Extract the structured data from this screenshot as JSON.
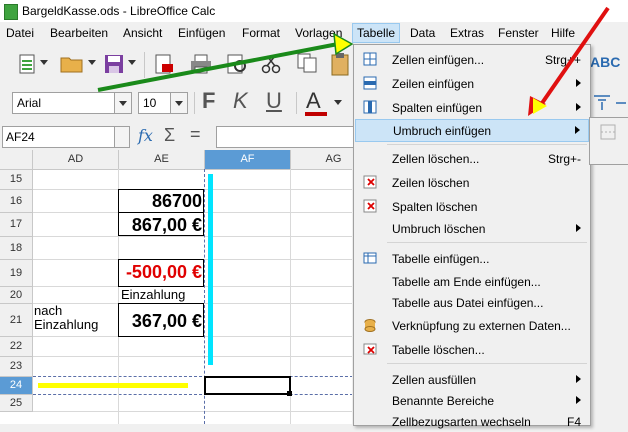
{
  "window": {
    "title": "BargeldKasse.ods - LibreOffice Calc"
  },
  "menubar": [
    {
      "id": "datei",
      "label": "Datei"
    },
    {
      "id": "bearbeiten",
      "label": "Bearbeiten"
    },
    {
      "id": "ansicht",
      "label": "Ansicht"
    },
    {
      "id": "einfuegen",
      "label": "Einfügen"
    },
    {
      "id": "format",
      "label": "Format"
    },
    {
      "id": "vorlagen",
      "label": "Vorlagen"
    },
    {
      "id": "tabelle",
      "label": "Tabelle"
    },
    {
      "id": "daten",
      "label": "Data"
    },
    {
      "id": "extras",
      "label": "Extras"
    },
    {
      "id": "fenster",
      "label": "Fenster"
    },
    {
      "id": "hilfe",
      "label": "Hilfe"
    }
  ],
  "formatting": {
    "font_name": "Arial",
    "font_size": "10",
    "bold": "F",
    "italic": "K",
    "underline": "U",
    "font_color": "A"
  },
  "formula_bar": {
    "name_box": "AF24",
    "fx": "fx",
    "sum": "Σ",
    "equals": "="
  },
  "grid": {
    "columns": [
      "AD",
      "AE",
      "AF",
      "AG"
    ],
    "rows": [
      "15",
      "16",
      "17",
      "18",
      "19",
      "20",
      "21",
      "22",
      "23",
      "24",
      "25"
    ],
    "cells": {
      "ae16": "86700",
      "ae17": "867,00 €",
      "ae19": "-500,00 €",
      "ae20": "Einzahlung",
      "ad21_line1": "nach",
      "ad21_line2": "Einzahlung",
      "ae21": "367,00 €"
    }
  },
  "table_menu": {
    "items": [
      {
        "label": "Zellen einfügen...",
        "shortcut": "Strg++"
      },
      {
        "label": "Zeilen einfügen"
      },
      {
        "label": "Spalten einfügen"
      },
      {
        "label": "Umbruch einfügen"
      },
      {
        "label": "Zellen löschen...",
        "shortcut": "Strg+-"
      },
      {
        "label": "Zeilen löschen"
      },
      {
        "label": "Spalten löschen"
      },
      {
        "label": "Umbruch löschen"
      },
      {
        "label": "Tabelle einfügen..."
      },
      {
        "label": "Tabelle am Ende einfügen..."
      },
      {
        "label": "Tabelle aus Datei einfügen..."
      },
      {
        "label": "Verknüpfung zu externen Daten..."
      },
      {
        "label": "Tabelle löschen..."
      },
      {
        "label": "Zellen ausfüllen"
      },
      {
        "label": "Benannte Bereiche"
      },
      {
        "label": "Zellbezugsarten wechseln",
        "shortcut": "F4"
      }
    ]
  },
  "colors": {
    "menu_highlight": "#cce4f7",
    "negative_value": "#e00000",
    "annotation_green": "#1a8a1a",
    "annotation_red": "#e01010",
    "annotation_yellow": "#ffff00",
    "annotation_cyan": "#00e5ff",
    "selected_header": "#5b9bd5"
  }
}
